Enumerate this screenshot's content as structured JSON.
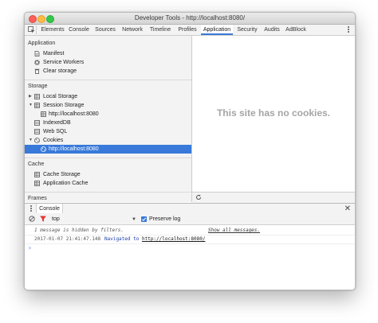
{
  "window": {
    "title": "Developer Tools - http://localhost:8080/"
  },
  "tabs": [
    "Elements",
    "Console",
    "Sources",
    "Network",
    "Timeline",
    "Profiles",
    "Application",
    "Security",
    "Audits",
    "AdBlock"
  ],
  "active_tab": "Application",
  "sidebar": {
    "application": {
      "header": "Application",
      "items": [
        "Manifest",
        "Service Workers",
        "Clear storage"
      ]
    },
    "storage": {
      "header": "Storage",
      "local_storage": "Local Storage",
      "session_storage": "Session Storage",
      "session_storage_child": "http://localhost:8080",
      "indexeddb": "IndexedDB",
      "web_sql": "Web SQL",
      "cookies": "Cookies",
      "cookies_child": "http://localhost:8080"
    },
    "cache": {
      "header": "Cache",
      "items": [
        "Cache Storage",
        "Application Cache"
      ]
    },
    "frames": {
      "header": "Frames"
    }
  },
  "main": {
    "empty_message": "This site has no cookies."
  },
  "drawer": {
    "tab": "Console",
    "context": "top",
    "preserve_log_label": "Preserve log",
    "preserve_log_checked": true,
    "hidden_message": "1 message is hidden by filters.",
    "show_all": "Show all messages.",
    "log": {
      "timestamp": "2017-01-07 21:41:47.148",
      "text": "Navigated to",
      "link": "http://localhost:8080/"
    },
    "prompt": "›"
  },
  "colors": {
    "accent": "#3879d9",
    "close_red": "#fc605b",
    "minimize_yellow": "#fdbc40",
    "zoom_green": "#34c84a"
  }
}
